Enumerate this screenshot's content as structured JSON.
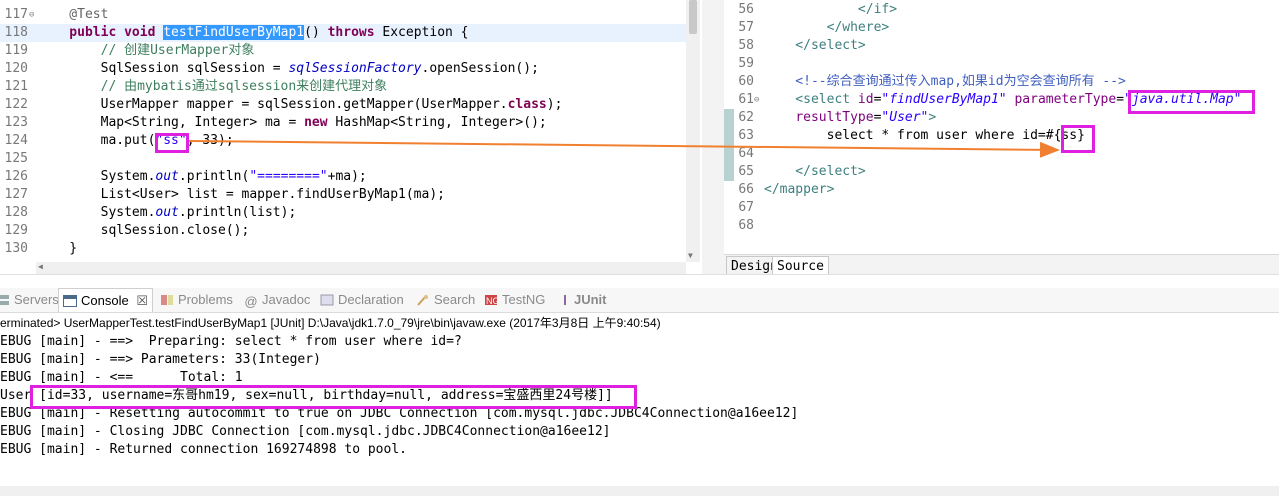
{
  "java_editor": {
    "lines": [
      {
        "num": "117",
        "parts": [
          [
            "ann",
            "    @Test"
          ]
        ]
      },
      {
        "num": "118",
        "parts": [
          [
            "kw",
            "    public void "
          ],
          [
            "sel",
            "testFindUserByMap1"
          ],
          [
            "",
            "() "
          ],
          [
            "kw",
            "throws"
          ],
          [
            "",
            " Exception {"
          ]
        ]
      },
      {
        "num": "119",
        "parts": [
          [
            "cm",
            "        // 创建UserMapper对象"
          ]
        ]
      },
      {
        "num": "120",
        "parts": [
          [
            "",
            "        SqlSession sqlSession = "
          ],
          [
            "fld",
            "sqlSessionFactory"
          ],
          [
            "",
            ".openSession();"
          ]
        ]
      },
      {
        "num": "121",
        "parts": [
          [
            "cm",
            "        // 由mybatis通过sqlsession来创建代理对象"
          ]
        ]
      },
      {
        "num": "122",
        "parts": [
          [
            "",
            "        UserMapper mapper = sqlSession.getMapper(UserMapper."
          ],
          [
            "kw",
            "class"
          ],
          [
            "",
            ");"
          ]
        ]
      },
      {
        "num": "123",
        "parts": [
          [
            "",
            "        Map<String, Integer> ma = "
          ],
          [
            "kw",
            "new"
          ],
          [
            "",
            " HashMap<String, Integer>();"
          ]
        ]
      },
      {
        "num": "124",
        "parts": [
          [
            "",
            "        ma.put("
          ],
          [
            "str",
            "\"ss\""
          ],
          [
            "",
            ", 33);"
          ]
        ]
      },
      {
        "num": "125",
        "parts": [
          [
            "",
            ""
          ]
        ]
      },
      {
        "num": "126",
        "parts": [
          [
            "",
            "        System."
          ],
          [
            "fld",
            "out"
          ],
          [
            "",
            ".println("
          ],
          [
            "str",
            "\"========\""
          ],
          [
            "",
            "+ma);"
          ]
        ]
      },
      {
        "num": "127",
        "parts": [
          [
            "",
            "        List<User> list = mapper.findUserByMap1(ma);"
          ]
        ]
      },
      {
        "num": "128",
        "parts": [
          [
            "",
            "        System."
          ],
          [
            "fld",
            "out"
          ],
          [
            "",
            ".println(list);"
          ]
        ]
      },
      {
        "num": "129",
        "parts": [
          [
            "",
            "        sqlSession.close();"
          ]
        ]
      },
      {
        "num": "130",
        "parts": [
          [
            "",
            "    }"
          ]
        ]
      }
    ]
  },
  "xml_editor": {
    "lines": [
      {
        "num": "56",
        "parts": [
          [
            "tag",
            "            </if>"
          ]
        ]
      },
      {
        "num": "57",
        "parts": [
          [
            "tag",
            "        </where>"
          ]
        ]
      },
      {
        "num": "58",
        "parts": [
          [
            "tag",
            "    </select>"
          ]
        ]
      },
      {
        "num": "59",
        "parts": [
          [
            "",
            ""
          ]
        ]
      },
      {
        "num": "60",
        "parts": [
          [
            "xcm",
            "    <!--综合查询通过传入map,如果id为空会查询所有 -->"
          ]
        ]
      },
      {
        "num": "61",
        "parts": [
          [
            "tag",
            "    <select "
          ],
          [
            "attr",
            "id"
          ],
          [
            "",
            "="
          ],
          [
            "aval",
            "\"findUserByMap1\""
          ],
          [
            "",
            " "
          ],
          [
            "attr",
            "parameterType"
          ],
          [
            "",
            "="
          ],
          [
            "aval",
            "\"java.util.Map\""
          ]
        ]
      },
      {
        "num": "62",
        "parts": [
          [
            "",
            "    "
          ],
          [
            "attr",
            "resultType"
          ],
          [
            "",
            "="
          ],
          [
            "aval",
            "\"User\""
          ],
          [
            "tag",
            ">"
          ]
        ]
      },
      {
        "num": "63",
        "parts": [
          [
            "",
            "        select * from user where id=#{ss}"
          ]
        ]
      },
      {
        "num": "64",
        "parts": [
          [
            "",
            ""
          ]
        ]
      },
      {
        "num": "65",
        "parts": [
          [
            "tag",
            "    </select>"
          ]
        ]
      },
      {
        "num": "66",
        "parts": [
          [
            "tag",
            "</mapper>"
          ]
        ]
      },
      {
        "num": "67",
        "parts": [
          [
            "",
            ""
          ]
        ]
      },
      {
        "num": "68",
        "parts": [
          [
            "",
            ""
          ]
        ]
      }
    ],
    "tabs": [
      "Design",
      "Source"
    ],
    "active_tab": "Source"
  },
  "views_bar": {
    "tabs": [
      {
        "label": "Servers",
        "icon": "servers-icon",
        "active": false
      },
      {
        "label": "Console",
        "icon": "console-icon",
        "active": true
      },
      {
        "label": "Problems",
        "icon": "problems-icon",
        "active": false
      },
      {
        "label": "Javadoc",
        "icon": "javadoc-icon",
        "active": false
      },
      {
        "label": "Declaration",
        "icon": "declaration-icon",
        "active": false
      },
      {
        "label": "Search",
        "icon": "search-icon",
        "active": false
      },
      {
        "label": "TestNG",
        "icon": "testng-icon",
        "active": false
      },
      {
        "label": "JUnit",
        "icon": "junit-icon",
        "active": false
      }
    ],
    "close_glyph": "☒"
  },
  "console": {
    "header": "erminated> UserMapperTest.testFindUserByMap1 [JUnit] D:\\Java\\jdk1.7.0_79\\jre\\bin\\javaw.exe (2017年3月8日 上午9:40:54)",
    "lines": [
      "EBUG [main] - ==>  Preparing: select * from user where id=? ",
      "EBUG [main] - ==> Parameters: 33(Integer)",
      "EBUG [main] - <==      Total: 1",
      "User [id=33, username=东哥hm19, sex=null, birthday=null, address=宝盛西里24号楼]]",
      "EBUG [main] - Resetting autocommit to true on JDBC Connection [com.mysql.jdbc.JDBC4Connection@a16ee12]",
      "EBUG [main] - Closing JDBC Connection [com.mysql.jdbc.JDBC4Connection@a16ee12]",
      "EBUG [main] - Returned connection 169274898 to pool."
    ]
  },
  "colors": {
    "highlight_box": "#e020e0",
    "arrow": "#f08030",
    "selection": "#3399ff",
    "keyword": "#7f0055",
    "comment": "#3f7f5f",
    "string": "#2a00ff",
    "xml_tag": "#3f7f7f",
    "xml_attr": "#7f007f"
  }
}
